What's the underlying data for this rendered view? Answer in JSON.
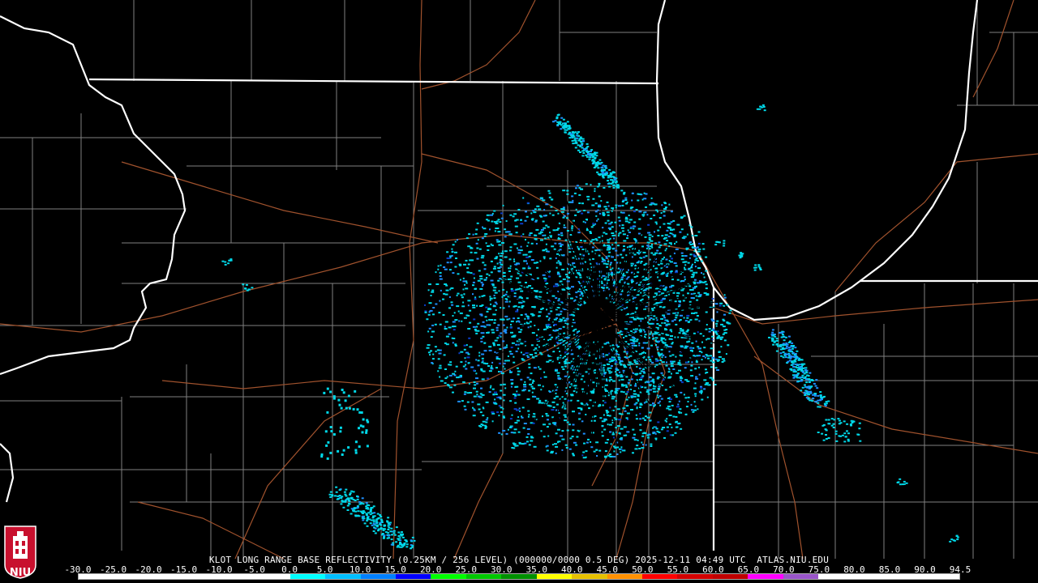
{
  "product": {
    "title": "KLOT LONG RANGE BASE REFLECTIVITY (0.25KM / 256 LEVEL) (000000/0000 0.5 DEG) 2025-12-11 04:49 UTC  ATLAS.NIU.EDU"
  },
  "logo": {
    "text": "NIU",
    "color": "#c8102e"
  },
  "scale": {
    "labels": [
      "-30.0",
      "-25.0",
      "-20.0",
      "-15.0",
      "-10.0",
      "-5.0",
      "0.0",
      "5.0",
      "10.0",
      "15.0",
      "20.0",
      "25.0",
      "30.0",
      "35.0",
      "40.0",
      "45.0",
      "50.0",
      "55.0",
      "60.0",
      "65.0",
      "70.0",
      "75.0",
      "80.0",
      "85.0",
      "90.0",
      "94.5"
    ],
    "colors": [
      "#ffffff",
      "#ffffff",
      "#ffffff",
      "#ffffff",
      "#ffffff",
      "#ffffff",
      "#00ffff",
      "#00bfff",
      "#0080ff",
      "#0000ff",
      "#00ff00",
      "#00c800",
      "#009000",
      "#ffff00",
      "#e6c000",
      "#ff9000",
      "#ff0000",
      "#d40000",
      "#c00000",
      "#ff00ff",
      "#9955c9",
      "#ffffff",
      "#ffffff",
      "#ffffff",
      "#ffffff"
    ]
  },
  "colors": {
    "state_border": "#ffffff",
    "county_border": "#808080",
    "highway": "#a0522d",
    "echo_light": "#00d8e8",
    "echo_mid": "#1e90ff",
    "echo_dark": "#0a3cc8"
  }
}
